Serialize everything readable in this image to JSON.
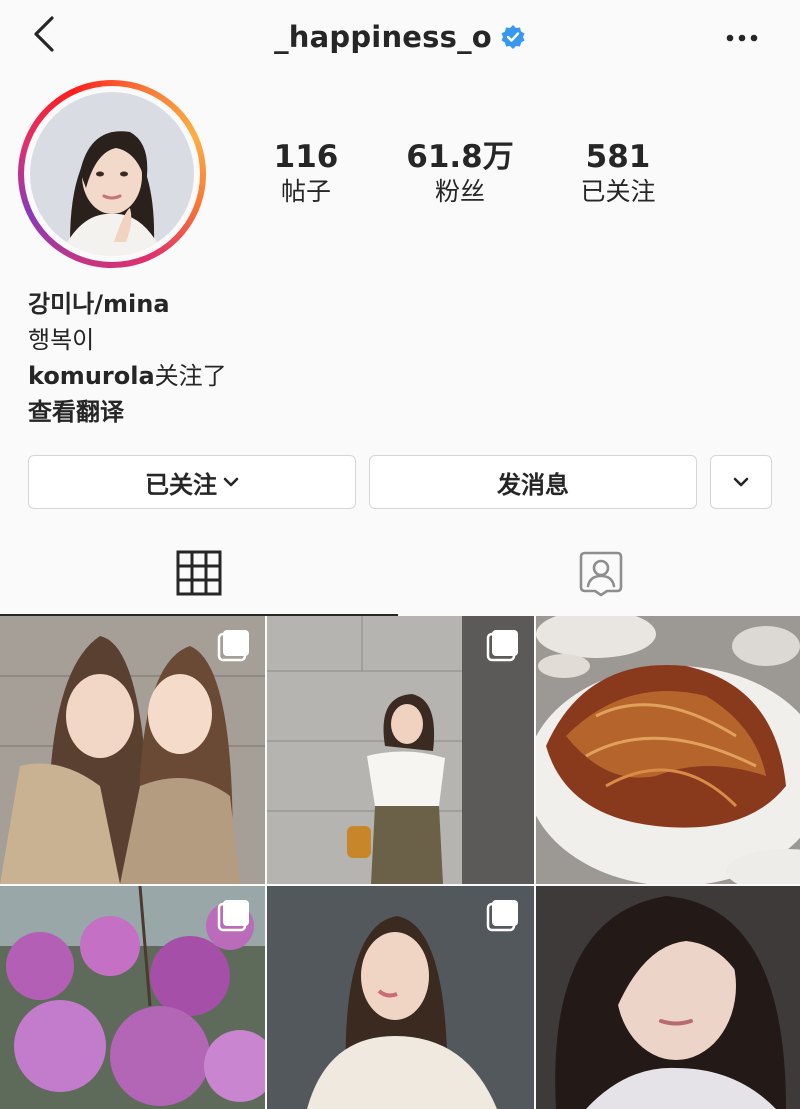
{
  "header": {
    "back_icon": "chevron-left-icon",
    "username": "_happiness_o",
    "verified_icon": "verified-badge-icon",
    "more_icon": "more-horizontal-icon"
  },
  "profile": {
    "avatar_icon": "avatar",
    "stats": [
      {
        "value": "116",
        "label": "帖子"
      },
      {
        "value": "61.8万",
        "label": "粉丝"
      },
      {
        "value": "581",
        "label": "已关注"
      }
    ],
    "name": "강미나/mina",
    "bio": "행복이",
    "followed_by_user": "komurola",
    "followed_by_suffix": "关注了",
    "translate": "查看翻译"
  },
  "actions": {
    "following_label": "已关注",
    "message_label": "发消息",
    "suggest_icon": "chevron-down-icon"
  },
  "tabs": [
    {
      "icon": "grid-icon",
      "active": true
    },
    {
      "icon": "tagged-user-icon",
      "active": false
    }
  ],
  "posts": [
    {
      "icon": "photo",
      "multiple": true
    },
    {
      "icon": "photo",
      "multiple": true
    },
    {
      "icon": "photo",
      "multiple": false
    },
    {
      "icon": "photo",
      "multiple": true
    },
    {
      "icon": "photo",
      "multiple": true
    },
    {
      "icon": "photo",
      "multiple": false
    }
  ],
  "colors": {
    "verified": "#3897f0",
    "text": "#262626",
    "border": "#d6d6d6"
  }
}
